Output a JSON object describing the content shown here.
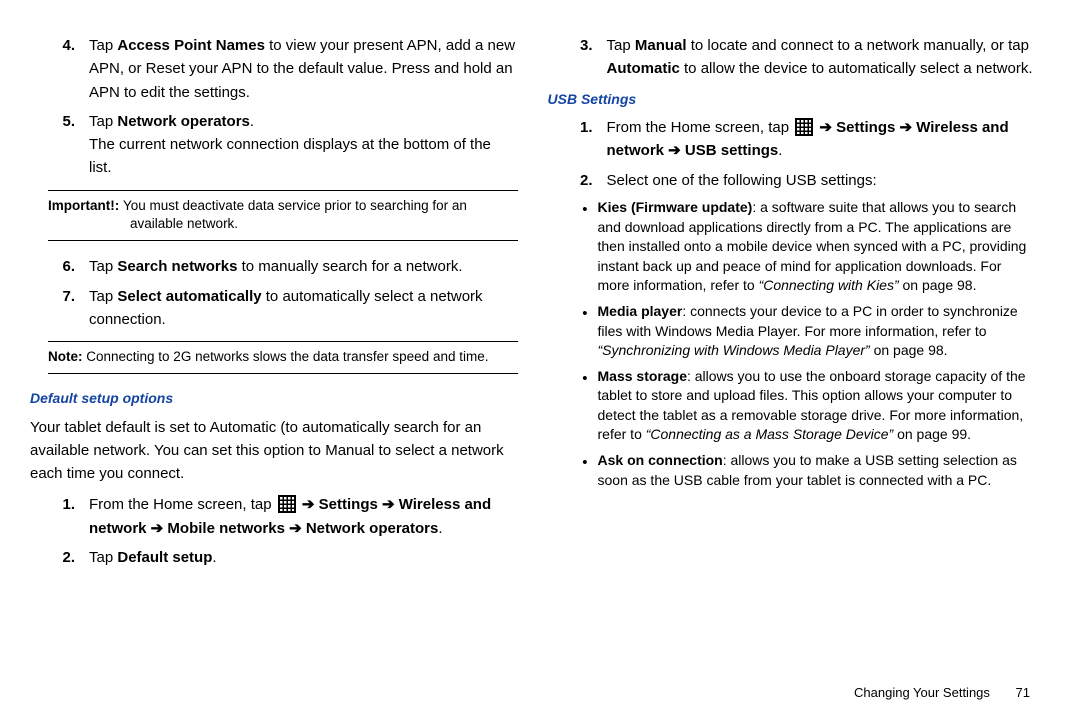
{
  "left": {
    "items": [
      {
        "num": "4.",
        "pre": "Tap ",
        "bold": "Access Point Names",
        "post": " to view your present APN, add a new APN, or Reset your APN to the default value. Press and hold an APN to edit the settings."
      },
      {
        "num": "5.",
        "pre": "Tap ",
        "bold": "Network operators",
        "post": ".",
        "extra": "The current network connection displays at the bottom of the list."
      }
    ],
    "important_label": "Important!: ",
    "important_text": "You must deactivate data service prior to searching for an available network.",
    "items2": [
      {
        "num": "6.",
        "pre": "Tap ",
        "bold": "Search networks",
        "post": " to manually search for a network."
      },
      {
        "num": "7.",
        "pre": "Tap ",
        "bold": "Select automatically",
        "post": " to automatically select a network connection."
      }
    ],
    "note_label": "Note: ",
    "note_text": "Connecting to 2G networks slows the data transfer speed and time.",
    "default_hdr": "Default setup options",
    "default_para": "Your tablet default is set to Automatic (to automatically search for an available network. You can set this option to Manual to select a network each time you connect.",
    "step1_lead": "From the Home screen, tap ",
    "step1_tail_a": " ➔ Settings ➔ Wireless and network ➔ Mobile networks ➔ Network operators",
    "step1_num": "1.",
    "step2_num": "2.",
    "step2_pre": "Tap ",
    "step2_bold": "Default setup",
    "step2_post": "."
  },
  "right": {
    "item3": {
      "num": "3.",
      "pre": "Tap ",
      "bold1": "Manual",
      "mid": " to locate and connect to a network manually, or tap ",
      "bold2": "Automatic",
      "post": " to allow the device to automatically select a network."
    },
    "usb_hdr": "USB Settings",
    "step1_num": "1.",
    "step1_lead": "From the Home screen, tap ",
    "step1_tail": " ➔ Settings ➔ Wireless and network ➔ USB settings",
    "step2_num": "2.",
    "step2_text": "Select one of the following USB settings:",
    "bullets": [
      {
        "bold": "Kies (Firmware update)",
        "text": ": a software suite that allows you to search and download applications directly from a PC. The applications are then installed onto a mobile device when synced with a PC, providing instant back up and peace of mind for application downloads. For more information, refer to ",
        "ref": "“Connecting with Kies”",
        "page": "  on page 98."
      },
      {
        "bold": "Media player",
        "text": ": connects your device to a PC in order to synchronize files with Windows Media Player. For more information, refer to ",
        "ref": "“Synchronizing with Windows Media Player”",
        "page": "  on page 98."
      },
      {
        "bold": "Mass storage",
        "text": ": allows you to use the onboard storage capacity of the tablet to store and upload files. This option allows your computer to detect the tablet as a removable storage drive. For more information, refer to ",
        "ref": "“Connecting as a Mass Storage Device”",
        "page": "  on page 99."
      },
      {
        "bold": "Ask on connection",
        "text": ": allows you to make a USB setting selection as soon as the USB cable from your tablet is connected with a PC.",
        "ref": "",
        "page": ""
      }
    ]
  },
  "footer": {
    "section": "Changing Your Settings",
    "page": "71"
  }
}
